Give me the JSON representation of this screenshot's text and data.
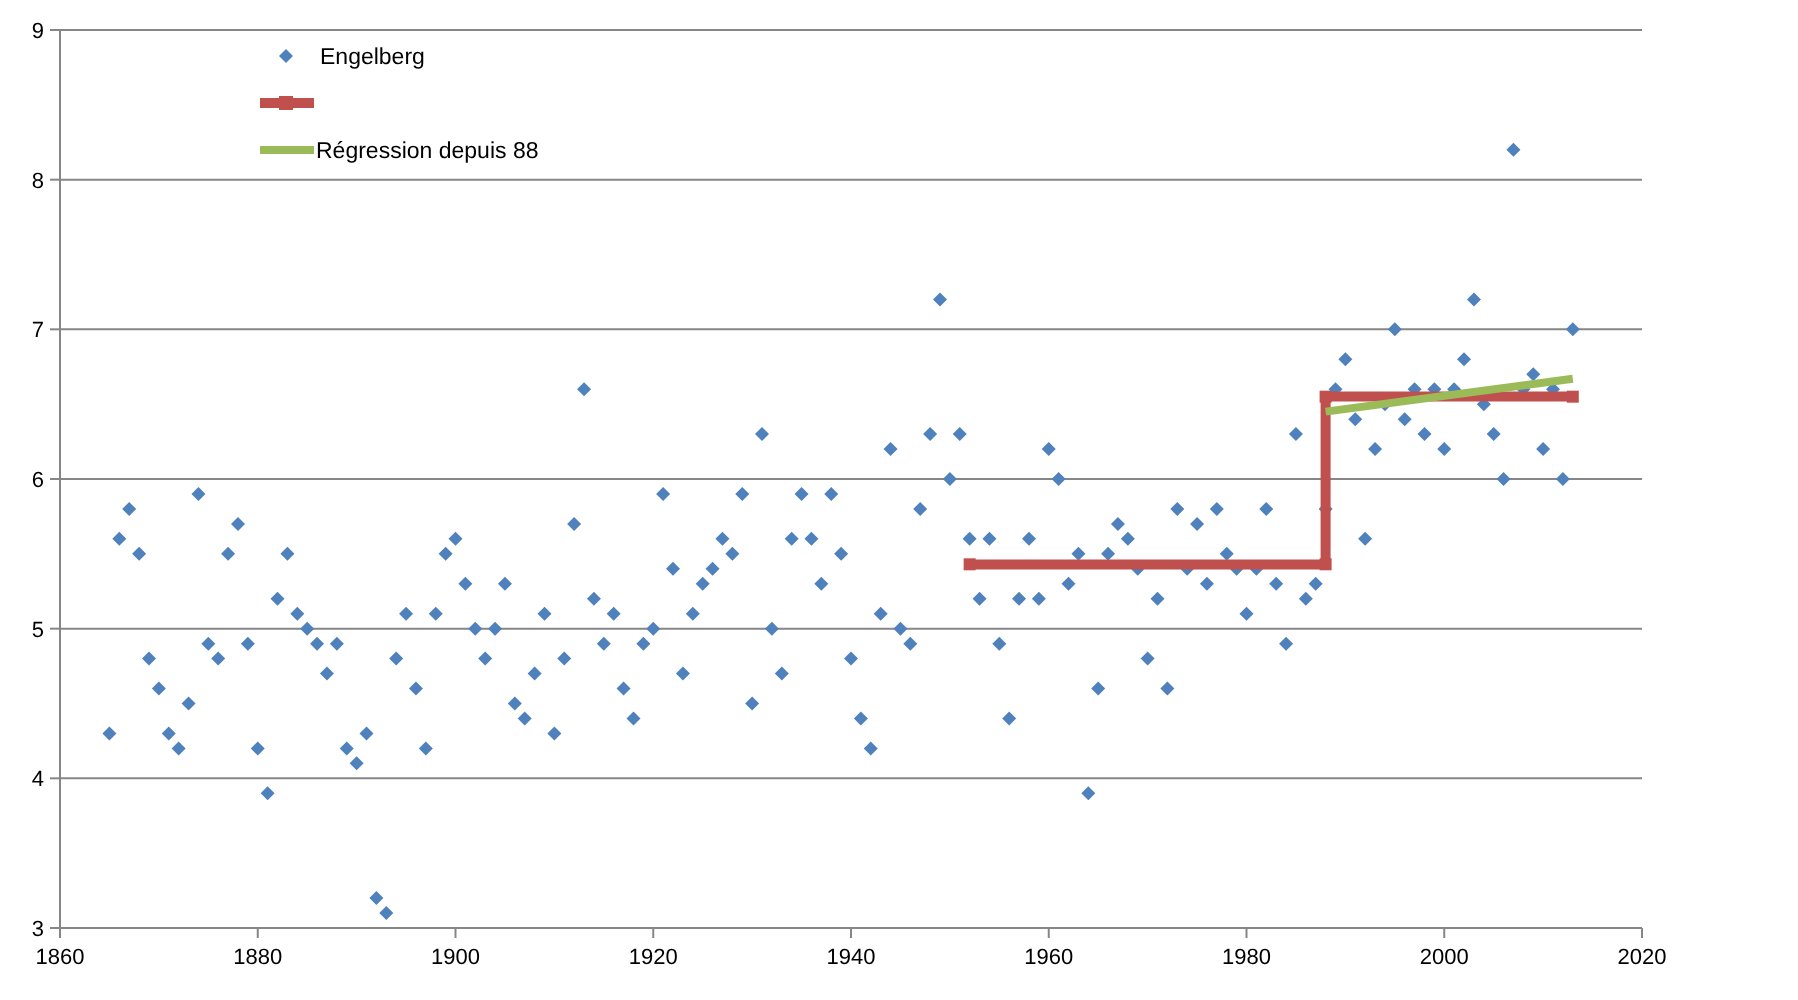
{
  "chart_data": {
    "type": "scatter",
    "grid": {
      "x": false,
      "y": true
    },
    "legend": true,
    "xlim": [
      1860,
      2020
    ],
    "ylim": [
      3,
      9
    ],
    "xticks": [
      1860,
      1880,
      1900,
      1920,
      1940,
      1960,
      1980,
      2000,
      2020
    ],
    "yticks": [
      3,
      4,
      5,
      6,
      7,
      8,
      9
    ],
    "series": [
      {
        "name": "Engelberg",
        "type": "scatter",
        "color": "#4f81bd",
        "x": [
          1865,
          1866,
          1867,
          1868,
          1869,
          1870,
          1871,
          1872,
          1873,
          1874,
          1875,
          1876,
          1877,
          1878,
          1879,
          1880,
          1881,
          1882,
          1883,
          1884,
          1885,
          1886,
          1887,
          1888,
          1889,
          1890,
          1891,
          1892,
          1893,
          1894,
          1895,
          1896,
          1897,
          1898,
          1899,
          1900,
          1901,
          1902,
          1903,
          1904,
          1905,
          1906,
          1907,
          1908,
          1909,
          1910,
          1911,
          1912,
          1913,
          1914,
          1915,
          1916,
          1917,
          1918,
          1919,
          1920,
          1921,
          1922,
          1923,
          1924,
          1925,
          1926,
          1927,
          1928,
          1929,
          1930,
          1931,
          1932,
          1933,
          1934,
          1935,
          1936,
          1937,
          1938,
          1939,
          1940,
          1941,
          1942,
          1943,
          1944,
          1945,
          1946,
          1947,
          1948,
          1949,
          1950,
          1951,
          1952,
          1953,
          1954,
          1955,
          1956,
          1957,
          1958,
          1959,
          1960,
          1961,
          1962,
          1963,
          1964,
          1965,
          1966,
          1967,
          1968,
          1969,
          1970,
          1971,
          1972,
          1973,
          1974,
          1975,
          1976,
          1977,
          1978,
          1979,
          1980,
          1981,
          1982,
          1983,
          1984,
          1985,
          1986,
          1987,
          1988,
          1989,
          1990,
          1991,
          1992,
          1993,
          1994,
          1995,
          1996,
          1997,
          1998,
          1999,
          2000,
          2001,
          2002,
          2003,
          2004,
          2005,
          2006,
          2007,
          2008,
          2009,
          2010,
          2011,
          2012,
          2013
        ],
        "values": [
          4.3,
          5.6,
          5.8,
          5.5,
          4.8,
          4.6,
          4.3,
          4.2,
          4.5,
          5.9,
          4.9,
          4.8,
          5.5,
          5.7,
          4.9,
          4.2,
          3.9,
          5.2,
          5.5,
          5.1,
          5.0,
          4.9,
          4.7,
          4.9,
          4.2,
          4.1,
          4.3,
          3.2,
          3.1,
          4.8,
          5.1,
          4.6,
          4.2,
          5.1,
          5.5,
          5.6,
          5.3,
          5.0,
          4.8,
          5.0,
          5.3,
          4.5,
          4.4,
          4.7,
          5.1,
          4.3,
          4.8,
          5.7,
          6.6,
          5.2,
          4.9,
          5.1,
          4.6,
          4.4,
          4.9,
          5.0,
          5.9,
          5.4,
          4.7,
          5.1,
          5.3,
          5.4,
          5.6,
          5.5,
          5.9,
          4.5,
          6.3,
          5.0,
          4.7,
          5.6,
          5.9,
          5.6,
          5.3,
          5.9,
          5.5,
          4.8,
          4.4,
          4.2,
          5.1,
          6.2,
          5.0,
          4.9,
          5.8,
          6.3,
          7.2,
          6.0,
          6.3,
          5.6,
          5.2,
          5.6,
          4.9,
          4.4,
          5.2,
          5.6,
          5.2,
          6.2,
          6.0,
          5.3,
          5.5,
          3.9,
          4.6,
          5.5,
          5.7,
          5.6,
          5.4,
          4.8,
          5.2,
          4.6,
          5.8,
          5.4,
          5.7,
          5.3,
          5.8,
          5.5,
          5.4,
          5.1,
          5.4,
          5.8,
          5.3,
          4.9,
          6.3,
          5.2,
          5.3,
          5.8,
          6.6,
          6.8,
          6.4,
          5.6,
          6.2,
          6.5,
          7.0,
          6.4,
          6.6,
          6.3,
          6.6,
          6.2,
          6.6,
          6.8,
          7.2,
          6.5,
          6.3,
          6.0,
          8.2,
          6.6,
          6.7,
          6.2,
          6.6,
          6.0,
          7.0
        ]
      },
      {
        "type": "line",
        "marker": "square",
        "color": "#c0504d",
        "x": [
          1952,
          1988,
          1988,
          2013
        ],
        "values": [
          5.43,
          5.43,
          6.55,
          6.55
        ]
      },
      {
        "name": "Régression depuis 88",
        "type": "line",
        "color": "#9bbb59",
        "x": [
          1988,
          2013
        ],
        "values": [
          6.45,
          6.67
        ]
      }
    ]
  }
}
